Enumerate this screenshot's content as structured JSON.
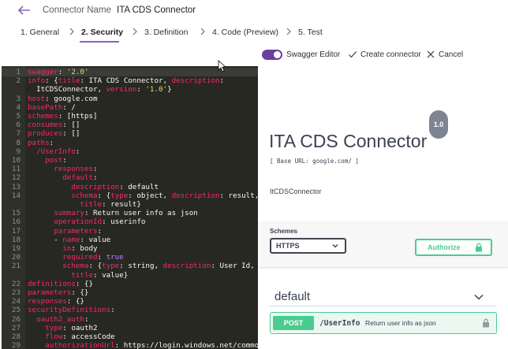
{
  "header": {
    "back_icon": "back-arrow-icon",
    "connector_name_label": "Connector Name",
    "connector_name_value": "ITA CDS Connector"
  },
  "steps": [
    {
      "label": "1. General",
      "active": false
    },
    {
      "label": "2. Security",
      "active": true
    },
    {
      "label": "3. Definition",
      "active": false
    },
    {
      "label": "4. Code (Preview)",
      "active": false
    },
    {
      "label": "5. Test",
      "active": false
    }
  ],
  "toolbar": {
    "swagger_editor_label": "Swagger Editor",
    "swagger_editor_on": true,
    "create_connector_label": "Create connector",
    "cancel_label": "Cancel"
  },
  "editor": {
    "lines": [
      {
        "n": "1",
        "text": "swagger: '2.0'"
      },
      {
        "n": "2",
        "text": "info: {title: ITA CDS Connector, description:"
      },
      {
        "n": "",
        "text": "  ItCDSConnector, version: '1.0'}"
      },
      {
        "n": "3",
        "text": "host: google.com"
      },
      {
        "n": "4",
        "text": "basePath: /"
      },
      {
        "n": "5",
        "text": "schemes: [https]"
      },
      {
        "n": "6",
        "text": "consumes: []"
      },
      {
        "n": "7",
        "text": "produces: []"
      },
      {
        "n": "8",
        "text": "paths:"
      },
      {
        "n": "9",
        "text": "  /UserInfo:"
      },
      {
        "n": "10",
        "text": "    post:"
      },
      {
        "n": "11",
        "text": "      responses:"
      },
      {
        "n": "12",
        "text": "        default:"
      },
      {
        "n": "13",
        "text": "          description: default"
      },
      {
        "n": "14",
        "text": "          schema: {type: object, description: result,"
      },
      {
        "n": "",
        "text": "            title: result}"
      },
      {
        "n": "15",
        "text": "      summary: Return user info as json"
      },
      {
        "n": "16",
        "text": "      operationId: userinfo"
      },
      {
        "n": "17",
        "text": "      parameters:"
      },
      {
        "n": "18",
        "text": "      - name: value"
      },
      {
        "n": "19",
        "text": "        in: body"
      },
      {
        "n": "20",
        "text": "        required: true"
      },
      {
        "n": "21",
        "text": "        schema: {type: string, description: User Id,"
      },
      {
        "n": "",
        "text": "          title: value}"
      },
      {
        "n": "22",
        "text": "definitions: {}"
      },
      {
        "n": "23",
        "text": "parameters: {}"
      },
      {
        "n": "24",
        "text": "responses: {}"
      },
      {
        "n": "25",
        "text": "securityDefinitions:"
      },
      {
        "n": "26",
        "text": "  oauth2_auth:"
      },
      {
        "n": "27",
        "text": "    type: oauth2"
      },
      {
        "n": "28",
        "text": "    flow: accessCode"
      },
      {
        "n": "29",
        "text": "    authorizationUrl: https://login.windows.net/common"
      }
    ]
  },
  "preview": {
    "title": "ITA CDS Connector",
    "version": "1.0",
    "base_url": "[ Base URL: google.com/ ]",
    "description": "ItCDSConnector",
    "schemes_label": "Schemes",
    "scheme_selected": "HTTPS",
    "authorize_label": "Authorize",
    "section_name": "default",
    "operation": {
      "method": "POST",
      "path": "/UserInfo",
      "summary": "Return user info as json"
    }
  },
  "colors": {
    "accent": "#8764b8",
    "toggle": "#6b3fa0",
    "editor_bg": "#272822",
    "post_green": "#49cc90"
  }
}
